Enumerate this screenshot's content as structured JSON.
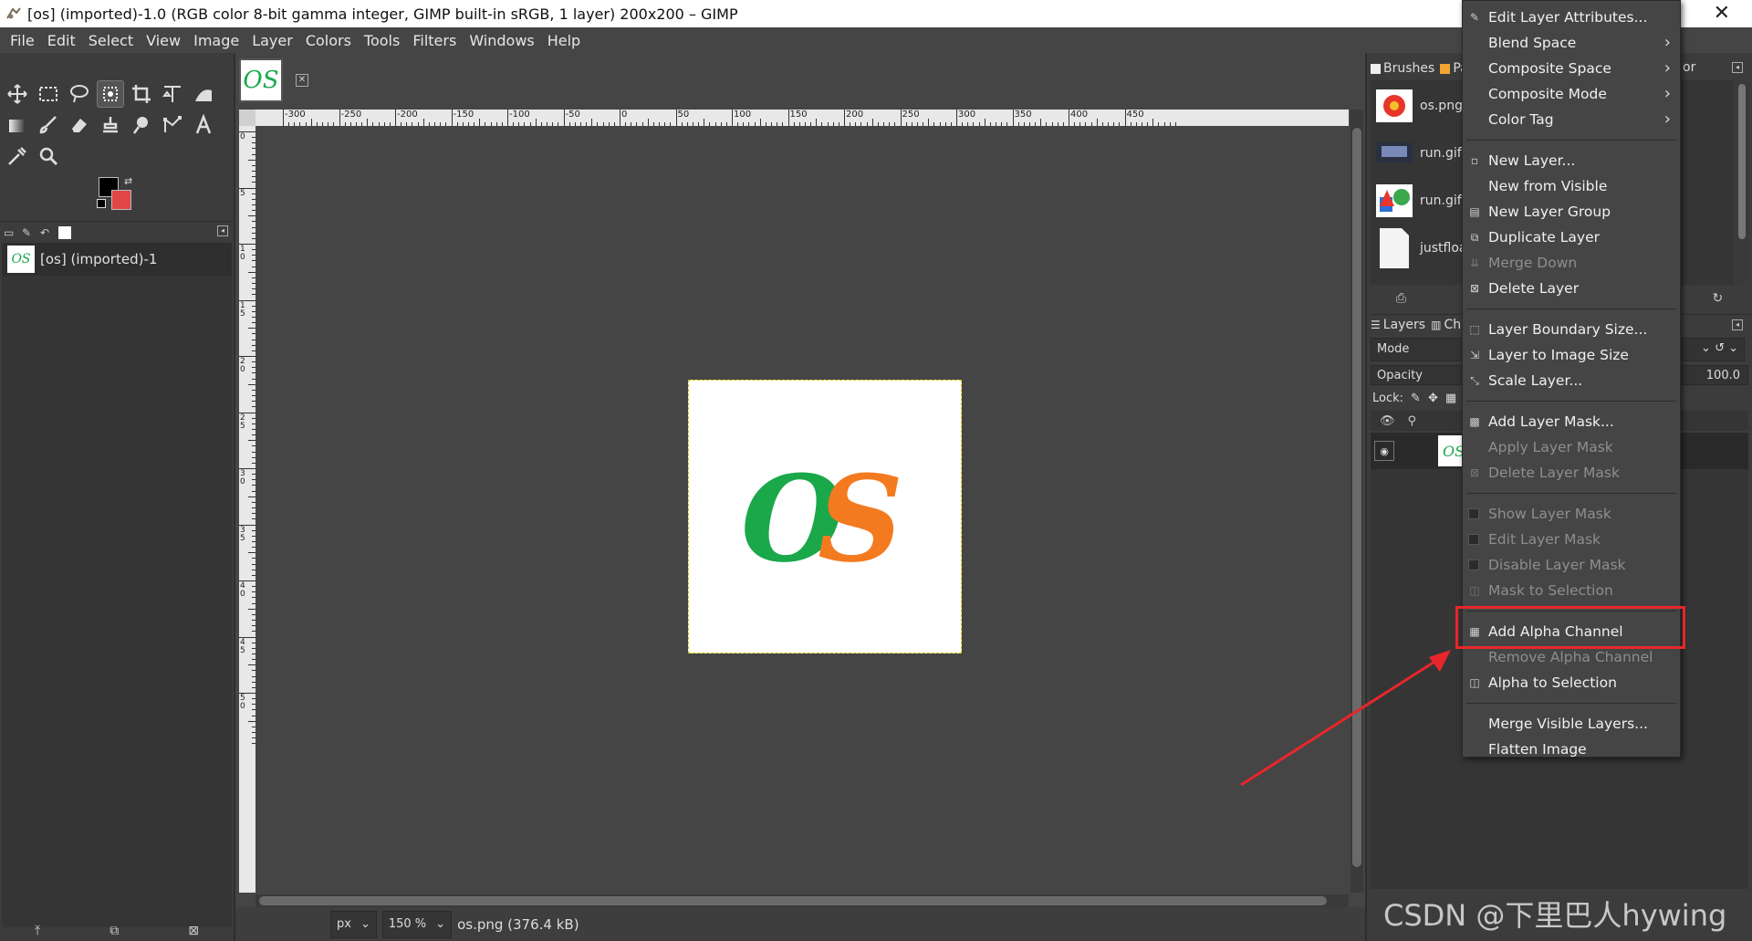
{
  "window": {
    "title": "[os] (imported)-1.0 (RGB color 8-bit gamma integer, GIMP built-in sRGB, 1 layer) 200x200 – GIMP",
    "close_symbol": "✕"
  },
  "menubar": [
    "File",
    "Edit",
    "Select",
    "View",
    "Image",
    "Layer",
    "Colors",
    "Tools",
    "Filters",
    "Windows",
    "Help"
  ],
  "images_panel": {
    "image_label": "[os] (imported)-1",
    "thumb_text": "OS"
  },
  "canvas": {
    "tab_thumb_text": "OS",
    "image_text_o": "O",
    "image_text_s": "S",
    "color_o": "#1aa84b",
    "color_s": "#f47a20",
    "hruler_labels": [
      "-300",
      "-250",
      "-200",
      "-150",
      "-100",
      "-50",
      "0",
      "50",
      "100",
      "150",
      "200",
      "250",
      "300",
      "350",
      "400",
      "450"
    ],
    "vruler_labels": [
      "0",
      "5",
      "1 0",
      "1 5",
      "2 0",
      "2 5",
      "3 0",
      "3 5",
      "4 0",
      "4 5",
      "5 0"
    ]
  },
  "statusbar": {
    "unit": "px",
    "zoom": "150 %",
    "file_info": "os.png (376.4 kB)"
  },
  "brushes_panel": {
    "tabs": [
      "Brushes",
      "Pa"
    ],
    "items": [
      "os.png",
      "run.gif (",
      "run.gif",
      "justfloat"
    ]
  },
  "layers_panel": {
    "tabs": [
      "Layers",
      "Char"
    ],
    "mode_label": "Mode",
    "opacity_label": "Opacity",
    "opacity_value": "100.0",
    "lock_label": "Lock:",
    "layer_thumb_text": "OS",
    "partial_tab": "or"
  },
  "context_menu": {
    "groups": [
      [
        {
          "label": "Edit Layer Attributes...",
          "icon": "edit-icon",
          "enabled": true,
          "submenu": false
        },
        {
          "label": "Blend Space",
          "icon": "",
          "enabled": true,
          "submenu": true
        },
        {
          "label": "Composite Space",
          "icon": "",
          "enabled": true,
          "submenu": true
        },
        {
          "label": "Composite Mode",
          "icon": "",
          "enabled": true,
          "submenu": true
        },
        {
          "label": "Color Tag",
          "icon": "",
          "enabled": true,
          "submenu": true
        }
      ],
      [
        {
          "label": "New Layer...",
          "icon": "new-layer-icon",
          "enabled": true,
          "submenu": false
        },
        {
          "label": "New from Visible",
          "icon": "",
          "enabled": true,
          "submenu": false
        },
        {
          "label": "New Layer Group",
          "icon": "folder-icon",
          "enabled": true,
          "submenu": false
        },
        {
          "label": "Duplicate Layer",
          "icon": "duplicate-icon",
          "enabled": true,
          "submenu": false
        },
        {
          "label": "Merge Down",
          "icon": "merge-down-icon",
          "enabled": false,
          "submenu": false
        },
        {
          "label": "Delete Layer",
          "icon": "delete-icon",
          "enabled": true,
          "submenu": false
        }
      ],
      [
        {
          "label": "Layer Boundary Size...",
          "icon": "boundary-icon",
          "enabled": true,
          "submenu": false
        },
        {
          "label": "Layer to Image Size",
          "icon": "fit-icon",
          "enabled": true,
          "submenu": false
        },
        {
          "label": "Scale Layer...",
          "icon": "scale-icon",
          "enabled": true,
          "submenu": false
        }
      ],
      [
        {
          "label": "Add Layer Mask...",
          "icon": "mask-icon",
          "enabled": true,
          "submenu": false
        },
        {
          "label": "Apply Layer Mask",
          "icon": "",
          "enabled": false,
          "submenu": false
        },
        {
          "label": "Delete Layer Mask",
          "icon": "delete-icon",
          "enabled": false,
          "submenu": false
        }
      ],
      [
        {
          "label": "Show Layer Mask",
          "icon": "checkbox",
          "enabled": false,
          "submenu": false
        },
        {
          "label": "Edit Layer Mask",
          "icon": "checkbox",
          "enabled": false,
          "submenu": false
        },
        {
          "label": "Disable Layer Mask",
          "icon": "checkbox",
          "enabled": false,
          "submenu": false
        },
        {
          "label": "Mask to Selection",
          "icon": "selection-icon",
          "enabled": false,
          "submenu": false
        }
      ],
      [
        {
          "label": "Add Alpha Channel",
          "icon": "alpha-icon",
          "enabled": true,
          "submenu": false
        },
        {
          "label": "Remove Alpha Channel",
          "icon": "",
          "enabled": false,
          "submenu": false
        },
        {
          "label": "Alpha to Selection",
          "icon": "selection-icon",
          "enabled": true,
          "submenu": false
        }
      ],
      [
        {
          "label": "Merge Visible Layers...",
          "icon": "",
          "enabled": true,
          "submenu": false
        },
        {
          "label": "Flatten Image",
          "icon": "",
          "enabled": true,
          "submenu": false
        }
      ]
    ]
  },
  "annotation": {
    "highlight_color": "#e8262a"
  },
  "watermark": "CSDN @下里巴人hywing"
}
